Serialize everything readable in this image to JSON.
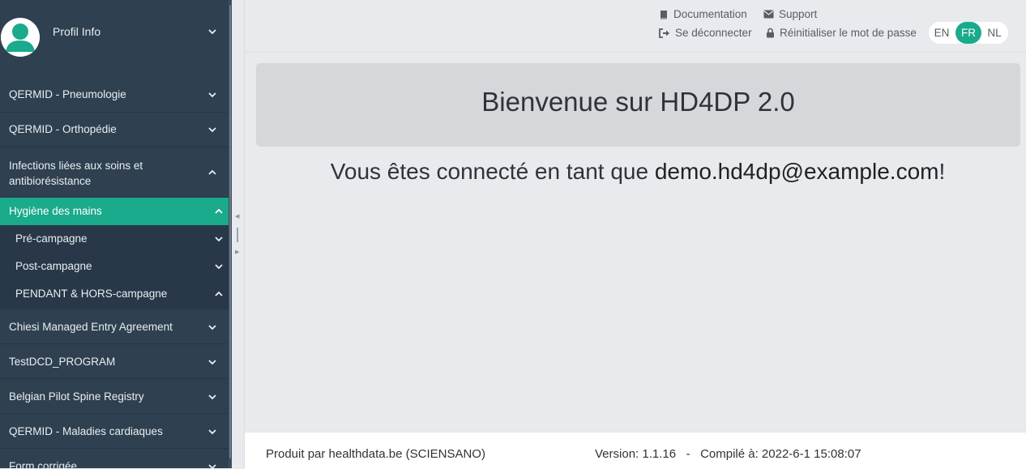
{
  "sidebar": {
    "profile_label": "Profil Info",
    "items": [
      {
        "label": "QERMID - Pneumologie"
      },
      {
        "label": "QERMID - Orthopédie"
      },
      {
        "label_line1": "Infections liées aux soins et",
        "label_line2": "antibiorésistance"
      },
      {
        "label": "Hygiène des mains"
      },
      {
        "label": "Chiesi Managed Entry Agreement"
      },
      {
        "label": "TestDCD_PROGRAM"
      },
      {
        "label": "Belgian Pilot Spine Registry"
      },
      {
        "label": "QERMID - Maladies cardiaques"
      },
      {
        "label": "Form corrigée"
      }
    ],
    "subitems": [
      {
        "label": "Pré-campagne"
      },
      {
        "label": "Post-campagne"
      },
      {
        "label": "PENDANT & HORS-campagne"
      }
    ],
    "colors": {
      "background": "#2f4050",
      "active": "#1aaa8c"
    }
  },
  "topbar": {
    "documentation": "Documentation",
    "support": "Support",
    "logout": "Se déconnecter",
    "reset_password": "Réinitialiser le mot de passe",
    "icons": [
      "book-icon",
      "envelope-icon",
      "sign-out-icon",
      "lock-icon"
    ],
    "languages": [
      "EN",
      "FR",
      "NL"
    ],
    "active_language": "FR"
  },
  "main": {
    "welcome": "Bienvenue sur HD4DP 2.0",
    "connected_prefix": "Vous êtes connecté en tant que ",
    "email": "demo.hd4dp@example.com",
    "connected_suffix": "!"
  },
  "footer": {
    "produced_by": "Produit par healthdata.be (SCIENSANO)",
    "version": "Version: 1.1.16   -   Compilé à: 2022-6-1 15:08:07"
  }
}
